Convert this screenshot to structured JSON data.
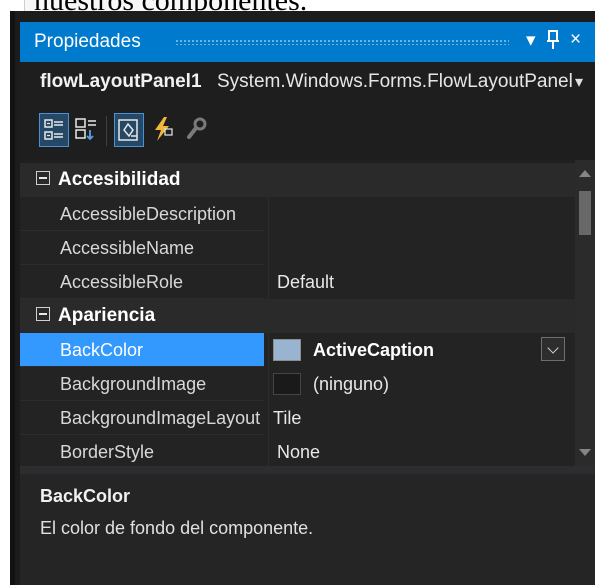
{
  "document": {
    "text_line": "nuestros componentes."
  },
  "panel": {
    "title": "Propiedades",
    "controls": {
      "menu": "▾",
      "pin": "ꟼ",
      "close": "×"
    },
    "accent_color": "#007acc"
  },
  "selector": {
    "object_name": "flowLayoutPanel1",
    "object_type": "System.Windows.Forms.FlowLayoutPanel",
    "caret": "▾"
  },
  "toolbar": {
    "buttons": [
      {
        "icon": "categorized-icon",
        "active": true
      },
      {
        "icon": "alphabetical-icon",
        "active": false
      },
      {
        "icon": "properties-icon",
        "active": true
      },
      {
        "icon": "events-lightning-icon",
        "active": false
      },
      {
        "icon": "property-pages-wrench-icon",
        "active": false
      }
    ]
  },
  "grid": {
    "categories": [
      {
        "label": "Accesibilidad",
        "properties": [
          {
            "name": "AccessibleDescription",
            "value": ""
          },
          {
            "name": "AccessibleName",
            "value": ""
          },
          {
            "name": "AccessibleRole",
            "value": "Default"
          }
        ]
      },
      {
        "label": "Apariencia",
        "properties": [
          {
            "name": "BackColor",
            "value": "ActiveCaption",
            "swatch": "#99b4d1",
            "selected": true
          },
          {
            "name": "BackgroundImage",
            "value": "(ninguno)",
            "swatch": "#1a1a1a"
          },
          {
            "name": "BackgroundImageLayout",
            "value": "Tile"
          },
          {
            "name": "BorderStyle",
            "value": "None"
          }
        ]
      }
    ],
    "selection_color": "#3399ff"
  },
  "description": {
    "title": "BackColor",
    "text": "El color de fondo del componente."
  }
}
